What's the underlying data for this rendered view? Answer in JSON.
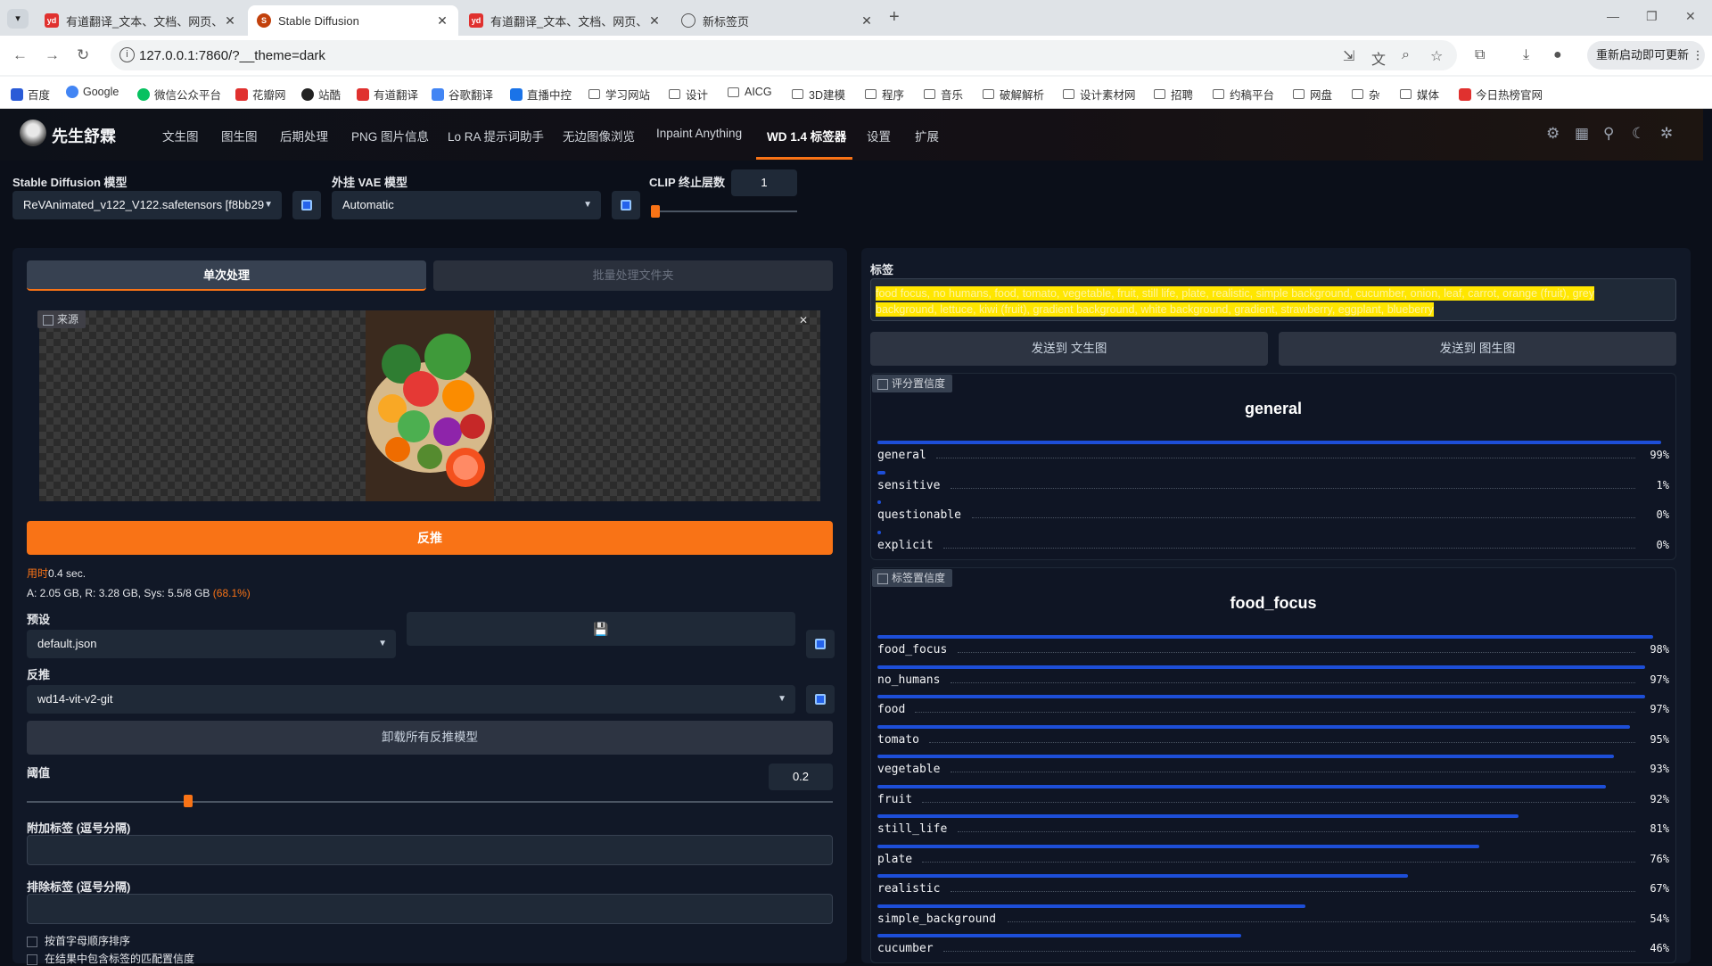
{
  "browser": {
    "tabs": [
      {
        "title": "有道翻译_文本、文档、网页、...",
        "icon": "youdao-icon",
        "active": false
      },
      {
        "title": "Stable Diffusion",
        "icon": "sd-icon",
        "active": true
      },
      {
        "title": "有道翻译_文本、文档、网页、...",
        "icon": "youdao-icon",
        "active": false
      },
      {
        "title": "新标签页",
        "icon": "globe-icon",
        "active": false
      }
    ],
    "url": "127.0.0.1:7860/?__theme=dark",
    "restart_label": "重新启动即可更新",
    "bookmarks": [
      "百度",
      "Google",
      "微信公众平台",
      "花瓣网",
      "站酷",
      "有道翻译",
      "谷歌翻译",
      "直播中控",
      "学习网站",
      "设计",
      "AICG",
      "3D建模",
      "程序",
      "音乐",
      "破解解析",
      "设计素材网",
      "招聘",
      "约稿平台",
      "网盘",
      "杂",
      "媒体",
      "今日热榜官网"
    ]
  },
  "app": {
    "brand": "先生舒霖",
    "nav": [
      "文生图",
      "图生图",
      "后期处理",
      "PNG 图片信息",
      "Lo RA 提示词助手",
      "无边图像浏览",
      "Inpaint Anything",
      "WD 1.4 标签器",
      "设置",
      "扩展"
    ],
    "active_nav": "WD 1.4 标签器",
    "accent": "#f97316"
  },
  "models": {
    "sd_label": "Stable Diffusion 模型",
    "sd_value": "ReVAnimated_v122_V122.safetensors [f8bb29",
    "vae_label": "外挂 VAE 模型",
    "vae_value": "Automatic",
    "clip_label": "CLIP 终止层数",
    "clip_value": "1"
  },
  "left": {
    "tab_single": "单次处理",
    "tab_batch": "批量处理文件夹",
    "image_label": "来源",
    "interrogate_btn": "反推",
    "time_label": "用时",
    "time_value": "0.4 sec.",
    "mem_a": "A: 2.05 GB, R: 3.28 GB, Sys: 5.5/8 GB",
    "mem_pct": "(68.1%)",
    "preset_label": "预设",
    "preset_value": "default.json",
    "interrogator_label": "反推",
    "interrogator_value": "wd14-vit-v2-git",
    "unload_btn": "卸载所有反推模型",
    "threshold_label": "阈值",
    "threshold_value": "0.2",
    "threshold_fraction": 0.2,
    "additional_label": "附加标签 (逗号分隔)",
    "exclude_label": "排除标签 (逗号分隔)",
    "sort_label": "按首字母顺序排序",
    "include_conf_label": "在结果中包含标签的匹配置信度"
  },
  "right": {
    "tags_label": "标签",
    "tags_text": "food focus, no humans, food, tomato, vegetable, fruit, still life, plate, realistic, simple background, cucumber, onion, leaf, carrot, orange (fruit), grey background, lettuce, kiwi (fruit), gradient background, white background, gradient, strawberry, eggplant, blueberry",
    "send_txt2img": "发送到 文生图",
    "send_img2img": "发送到 图生图",
    "rating_chip": "评分置信度",
    "rating_title": "general",
    "rating": [
      {
        "name": "general",
        "pct": "99%",
        "value": 0.99
      },
      {
        "name": "sensitive",
        "pct": "1%",
        "value": 0.01
      },
      {
        "name": "questionable",
        "pct": "0%",
        "value": 0.0
      },
      {
        "name": "explicit",
        "pct": "0%",
        "value": 0.0
      }
    ],
    "tag_chip": "标签置信度",
    "tag_title": "food_focus",
    "tags_conf": [
      {
        "name": "food_focus",
        "pct": "98%",
        "value": 0.98
      },
      {
        "name": "no_humans",
        "pct": "97%",
        "value": 0.97
      },
      {
        "name": "food",
        "pct": "97%",
        "value": 0.97
      },
      {
        "name": "tomato",
        "pct": "95%",
        "value": 0.95
      },
      {
        "name": "vegetable",
        "pct": "93%",
        "value": 0.93
      },
      {
        "name": "fruit",
        "pct": "92%",
        "value": 0.92
      },
      {
        "name": "still_life",
        "pct": "81%",
        "value": 0.81
      },
      {
        "name": "plate",
        "pct": "76%",
        "value": 0.76
      },
      {
        "name": "realistic",
        "pct": "67%",
        "value": 0.67
      },
      {
        "name": "simple_background",
        "pct": "54%",
        "value": 0.54
      },
      {
        "name": "cucumber",
        "pct": "46%",
        "value": 0.46
      }
    ]
  }
}
